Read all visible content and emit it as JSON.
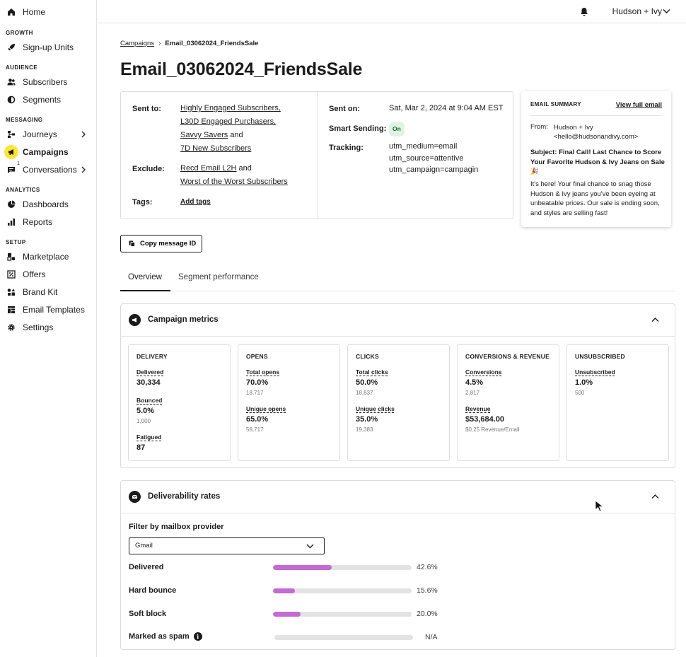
{
  "sidebar": {
    "home": "Home",
    "sections": {
      "growth": "GROWTH",
      "audience": "AUDIENCE",
      "messaging": "MESSAGING",
      "analytics": "ANALYTICS",
      "setup": "SETUP"
    },
    "items": {
      "signup_units": "Sign-up Units",
      "subscribers": "Subscribers",
      "segments": "Segments",
      "journeys": "Journeys",
      "campaigns": "Campaigns",
      "conversations": "Conversations",
      "conversations_badge": "1",
      "dashboards": "Dashboards",
      "reports": "Reports",
      "marketplace": "Marketplace",
      "offers": "Offers",
      "brand_kit": "Brand Kit",
      "email_templates": "Email Templates",
      "settings": "Settings"
    },
    "active_color": "#ffe53b"
  },
  "topbar": {
    "account_name": "Hudson + Ivy"
  },
  "breadcrumb": {
    "parent": "Campaigns",
    "current": "Email_03062024_FriendsSale"
  },
  "page_title": "Email_03062024_FriendsSale",
  "details": {
    "sent_to_label": "Sent to:",
    "sent_to": [
      "Highly Engaged Subscribers,",
      "L30D Engaged Purchasers,",
      "Savvy Savers",
      "7D New Subscribers"
    ],
    "sent_to_and": "and",
    "exclude_label": "Exclude:",
    "exclude": [
      "Recd Email L2H",
      "Worst of the Worst Subscribers"
    ],
    "exclude_and": "and",
    "tags_label": "Tags:",
    "tags_link": "Add tags",
    "sent_on_label": "Sent on:",
    "sent_on": "Sat, Mar 2, 2024 at 9:04 AM EST",
    "smart_sending_label": "Smart Sending:",
    "smart_sending": "On",
    "tracking_label": "Tracking:",
    "tracking": [
      "utm_medium=email",
      "utm_source=attentive",
      "utm_campaign=campagin"
    ]
  },
  "summary": {
    "heading": "EMAIL SUMMARY",
    "view_link": "View full email",
    "from_label": "From:",
    "from_name": "Hudson + Ivy",
    "from_email": "<hello@hudsonandivy.com>",
    "subject": "Subject: Final Call! Last Chance to Score Your Favorite Hudson & Ivy Jeans on Sale 🎉",
    "body": "It's here! Your final chance to snag those Hudson & Ivy jeans you've been eyeing at unbeatable prices. Our sale is ending soon, and styles are selling fast!"
  },
  "copy_button": "Copy message ID",
  "tabs": [
    "Overview",
    "Segment performance"
  ],
  "campaign_metrics": {
    "title": "Campaign metrics",
    "cards": [
      {
        "heading": "DELIVERY",
        "metrics": [
          {
            "label": "Delivered",
            "value": "30,334",
            "sub": ""
          },
          {
            "label": "Bounced",
            "value": "5.0%",
            "sub": "1,000"
          },
          {
            "label": "Fatigued",
            "value": "87",
            "sub": ""
          }
        ]
      },
      {
        "heading": "OPENS",
        "metrics": [
          {
            "label": "Total opens",
            "value": "70.0%",
            "sub": "18,717"
          },
          {
            "label": "Unique opens",
            "value": "65.0%",
            "sub": "58,717"
          }
        ]
      },
      {
        "heading": "CLICKS",
        "metrics": [
          {
            "label": "Total clicks",
            "value": "50.0%",
            "sub": "18,837"
          },
          {
            "label": "Unique clicks",
            "value": "35.0%",
            "sub": "19,383"
          }
        ]
      },
      {
        "heading": "CONVERSIONS & REVENUE",
        "metrics": [
          {
            "label": "Conversions",
            "value": "4.5%",
            "sub": "2,817"
          },
          {
            "label": "Revenue",
            "value": "$53,684.00",
            "sub": "$0.25 Revenue/Email"
          }
        ]
      },
      {
        "heading": "UNSUBSCRIBED",
        "metrics": [
          {
            "label": "Unsubscribed",
            "value": "1.0%",
            "sub": "500"
          }
        ]
      }
    ]
  },
  "deliverability": {
    "title": "Deliverability rates",
    "filter_label": "Filter by mailbox provider",
    "filter_value": "Gmail",
    "bar_color": "#c46ad3",
    "rates": [
      {
        "label": "Delivered",
        "text": "42.6%",
        "fraction": 0.426
      },
      {
        "label": "Hard bounce",
        "text": "15.6%",
        "fraction": 0.156
      },
      {
        "label": "Soft block",
        "text": "20.0%",
        "fraction": 0.2
      },
      {
        "label": "Marked as spam",
        "text": "N/A",
        "fraction": 0
      }
    ]
  }
}
